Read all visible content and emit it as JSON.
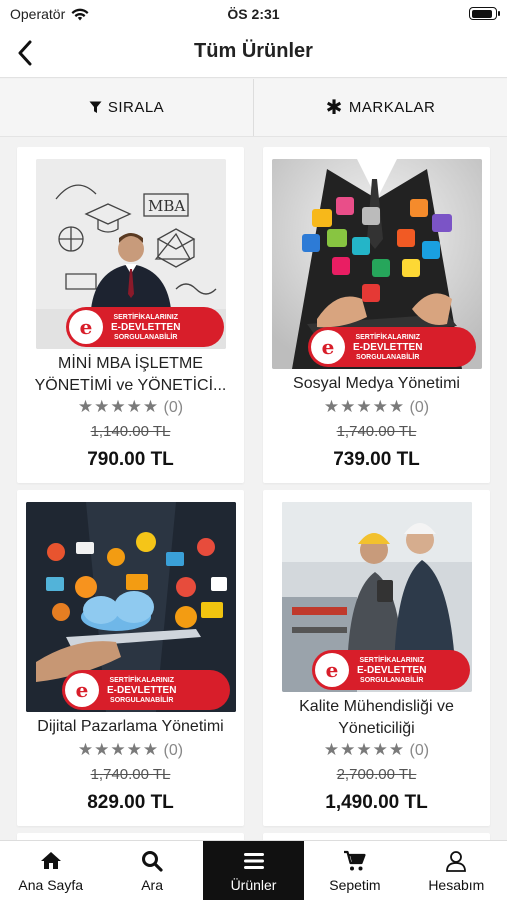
{
  "status_bar": {
    "carrier": "Operatör",
    "time": "ÖS 2:31",
    "battery_level": 0.9
  },
  "navbar": {
    "title": "Tüm Ürünler",
    "back_icon": "chevron-left-icon"
  },
  "filters": {
    "sort_label": "SIRALA",
    "sort_icon": "filter-funnel-icon",
    "brands_label": "MARKALAR",
    "brands_icon": "asterisk-icon"
  },
  "badge_text": {
    "line1": "SERTİFİKALARINIZ",
    "line2": "E-DEVLETTEN",
    "line3": "SORGULANABİLİR"
  },
  "products": [
    {
      "name": "MİNİ MBA İŞLETME YÖNETİMİ ve YÖNETİCİ...",
      "stars": "★★★★★",
      "rating_count": "(0)",
      "old_price": "1,140.00 TL",
      "price": "790.00 TL"
    },
    {
      "name": "Sosyal Medya Yönetimi",
      "stars": "★★★★★",
      "rating_count": "(0)",
      "old_price": "1,740.00 TL",
      "price": "739.00 TL"
    },
    {
      "name": "Dijital Pazarlama Yönetimi",
      "stars": "★★★★★",
      "rating_count": "(0)",
      "old_price": "1,740.00 TL",
      "price": "829.00 TL"
    },
    {
      "name": "Kalite Mühendisliği ve Yöneticiliği",
      "stars": "★★★★★",
      "rating_count": "(0)",
      "old_price": "2,700.00 TL",
      "price": "1,490.00 TL"
    }
  ],
  "tabbar": {
    "items": [
      {
        "label": "Ana Sayfa",
        "icon": "home-icon"
      },
      {
        "label": "Ara",
        "icon": "search-icon"
      },
      {
        "label": "Ürünler",
        "icon": "menu-icon"
      },
      {
        "label": "Sepetim",
        "icon": "cart-icon"
      },
      {
        "label": "Hesabım",
        "icon": "user-icon"
      }
    ],
    "active": "Ürünler"
  },
  "colors": {
    "brand_red": "#d81e2a",
    "active_tab": "#111111"
  }
}
